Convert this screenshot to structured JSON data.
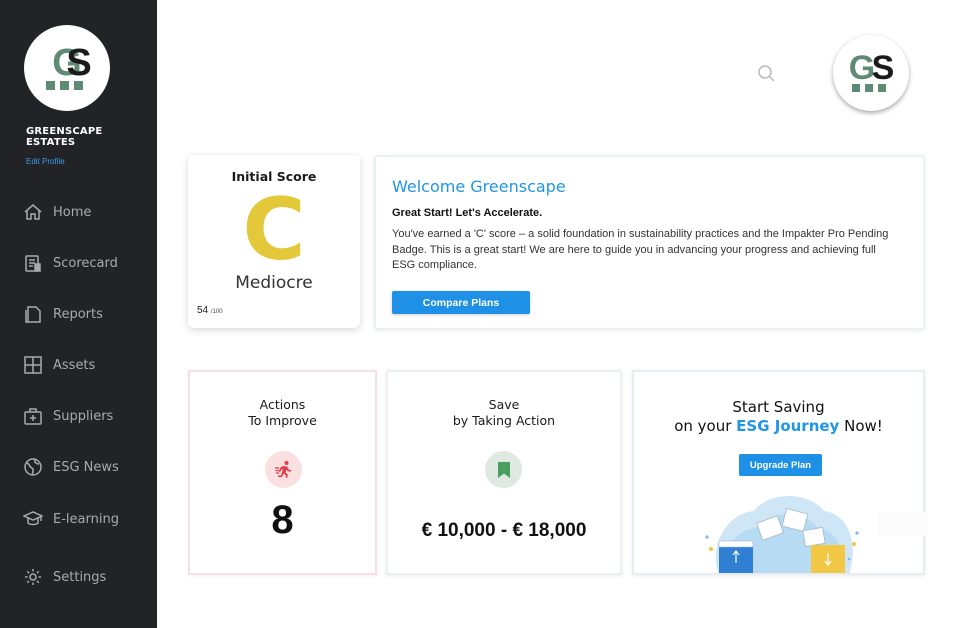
{
  "brand": {
    "logo_text": "GS",
    "company_name": "GREENSCAPE ESTATES",
    "edit_profile": "Edit Profile",
    "colors": {
      "logo_green": "#5f8a73",
      "sidebar": "#222327",
      "accent_blue": "#2196e3",
      "score_yellow": "#e3c93a"
    }
  },
  "sidebar": {
    "items": [
      {
        "label": "Home",
        "icon": "home-icon"
      },
      {
        "label": "Scorecard",
        "icon": "scorecard-icon"
      },
      {
        "label": "Reports",
        "icon": "reports-icon"
      },
      {
        "label": "Assets",
        "icon": "assets-icon"
      },
      {
        "label": "Suppliers",
        "icon": "suppliers-icon"
      },
      {
        "label": "ESG News",
        "icon": "globe-icon"
      },
      {
        "label": "E-learning",
        "icon": "graduation-cap-icon"
      },
      {
        "label": "Settings",
        "icon": "gear-icon"
      }
    ]
  },
  "header": {
    "search_icon": "search-icon",
    "avatar_text": "GS"
  },
  "score_card": {
    "title": "Initial Score",
    "letter": "C",
    "rating": "Mediocre",
    "score": "54",
    "max": "/100"
  },
  "welcome": {
    "title": "Welcome Greenscape",
    "subtitle": "Great Start! Let's Accelerate.",
    "body": "You've earned a 'C' score – a solid foundation in sustainability practices and the Impakter Pro Pending Badge. This is a great start!  We are here to guide you in advancing your progress and achieving full ESG compliance.",
    "button": "Compare Plans"
  },
  "actions_card": {
    "title_line1": "Actions",
    "title_line2": "To Improve",
    "count": "8",
    "icon": "running-person-icon"
  },
  "save_card": {
    "title_line1": "Save",
    "title_line2": "by Taking Action",
    "range": "€ 10,000 - € 18,000",
    "icon": "bookmark-icon"
  },
  "upgrade_card": {
    "line1": "Start Saving",
    "line2_prefix": "on your ",
    "line2_accent": "ESG Journey",
    "line2_suffix": " Now!",
    "button": "Upgrade Plan",
    "illustration": "folders-illustration"
  }
}
